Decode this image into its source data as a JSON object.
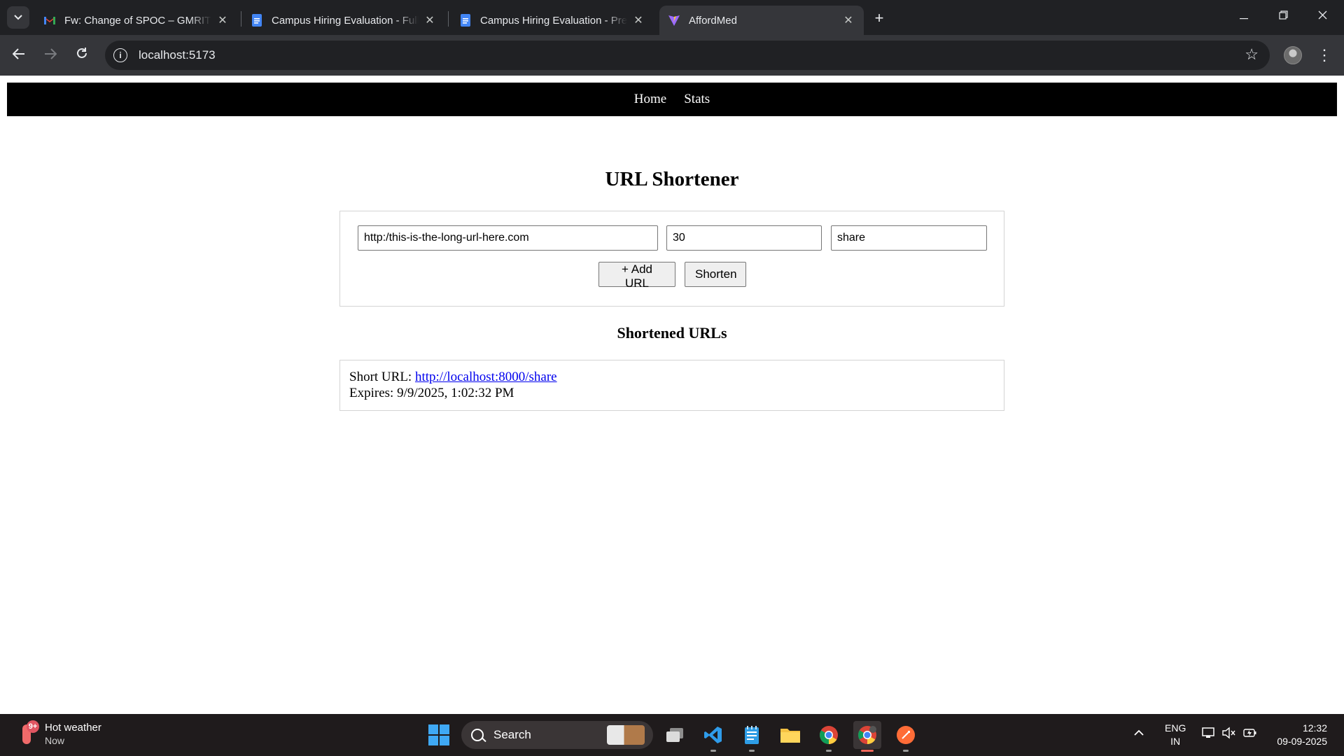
{
  "browser": {
    "tabs": [
      {
        "title": "Fw: Change of SPOC – GMRIT R",
        "favicon": "gmail-icon",
        "active": false
      },
      {
        "title": "Campus Hiring Evaluation - Full",
        "favicon": "google-docs-icon",
        "active": false
      },
      {
        "title": "Campus Hiring Evaluation - Pre",
        "favicon": "google-docs-icon",
        "active": false
      },
      {
        "title": "AffordMed",
        "favicon": "vite-icon",
        "active": true
      }
    ],
    "address": "localhost:5173"
  },
  "navbar": {
    "links": [
      "Home",
      "Stats"
    ]
  },
  "main": {
    "title": "URL Shortener",
    "form": {
      "long_url_value": "http:/this-is-the-long-url-here.com",
      "validity_value": "30",
      "shortcode_value": "share",
      "add_url_label": "+ Add URL",
      "shorten_label": "Shorten"
    },
    "results_title": "Shortened URLs",
    "results": [
      {
        "short_label": "Short URL:",
        "short_url": "http://localhost:8000/share",
        "expires_label": "Expires:",
        "expires_value": "9/9/2025, 1:02:32 PM"
      }
    ]
  },
  "taskbar": {
    "weather_title": "Hot weather",
    "weather_sub": "Now",
    "weather_badge": "9+",
    "search_label": "Search",
    "lang_1": "ENG",
    "lang_2": "IN",
    "time": "12:32",
    "date": "09-09-2025"
  }
}
